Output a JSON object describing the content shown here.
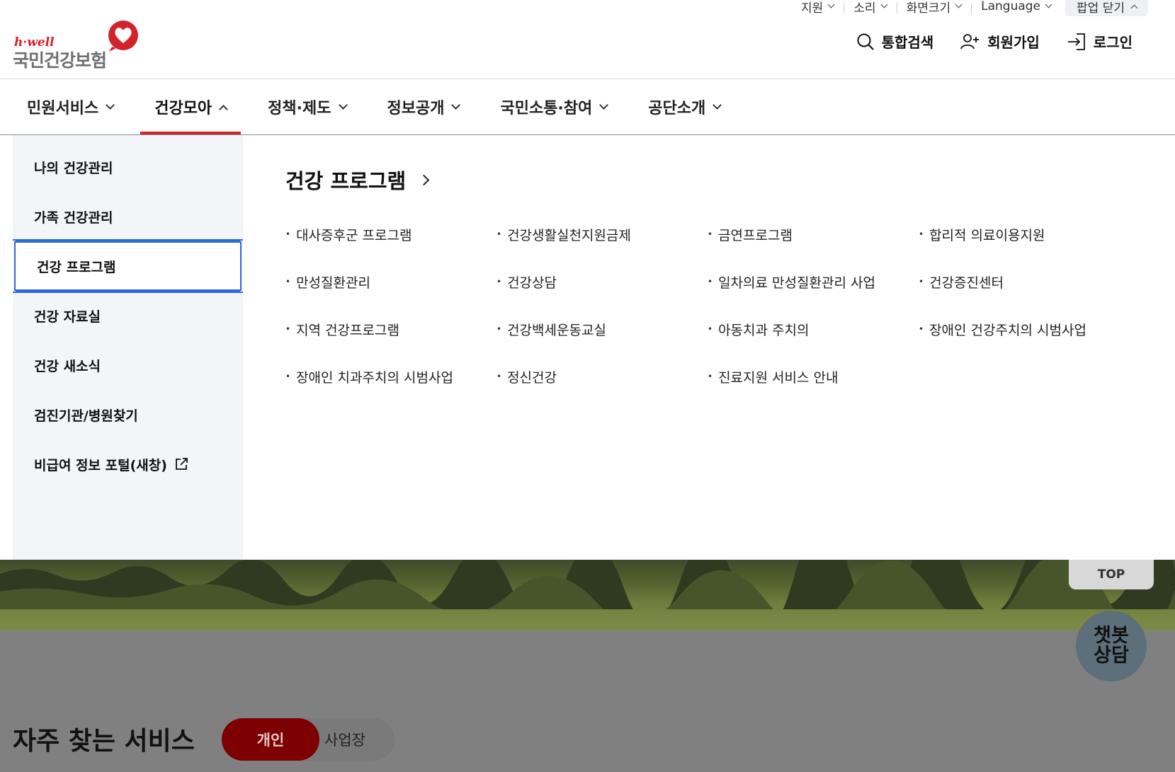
{
  "util": {
    "items": [
      "지원",
      "소리",
      "화면크기",
      "Language"
    ],
    "popup_close": "팝업 닫기"
  },
  "logo": {
    "small": "h·well",
    "name": "국민건강보험",
    "heart_color": "#d2232a"
  },
  "header": {
    "search": "통합검색",
    "signup": "회원가입",
    "login": "로그인"
  },
  "gnb": {
    "items": [
      "민원서비스",
      "건강모아",
      "정책·제도",
      "정보공개",
      "국민소통·참여",
      "공단소개"
    ],
    "active_index": 1,
    "accent": "#d2232a"
  },
  "lnb": {
    "items": [
      "나의 건강관리",
      "가족 건강관리",
      "건강 프로그램",
      "건강 자료실",
      "건강 새소식",
      "검진기관/병원찾기",
      "비급여 정보 포털(새창)"
    ],
    "selected_index": 2,
    "focus_color": "#2b6ad8"
  },
  "panel": {
    "title": "건강 프로그램",
    "links": [
      "대사증후군 프로그램",
      "건강생활실천지원금제",
      "금연프로그램",
      "합리적 의료이용지원",
      "만성질환관리",
      "건강상담",
      "일차의료 만성질환관리 사업",
      "건강증진센터",
      "지역 건강프로그램",
      "건강백세운동교실",
      "아동치과 주치의",
      "장애인 건강주치의 시범사업",
      "장애인 치과주치의 시범사업",
      "정신건강",
      "진료지원 서비스 안내"
    ]
  },
  "bottom": {
    "title": "자주 찾는 서비스",
    "seg_on": "개인",
    "seg_off": "사업장"
  },
  "floating": {
    "top": "TOP",
    "chatbot_line1": "챗봇",
    "chatbot_line2": "상담"
  }
}
